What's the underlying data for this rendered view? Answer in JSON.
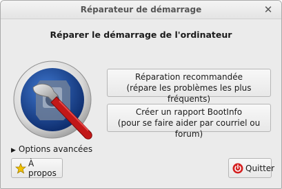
{
  "window": {
    "title": "Réparateur de démarrage"
  },
  "main": {
    "heading": "Réparer le démarrage de l'ordinateur",
    "repair_button": {
      "line1": "Réparation recommandée",
      "line2": "(répare les problèmes les plus fréquents)"
    },
    "bootinfo_button": {
      "line1": "Créer un rapport BootInfo",
      "line2": "(pour se faire aider par courriel ou forum)"
    },
    "options_label": "Options avancées"
  },
  "footer": {
    "about_label": "À propos",
    "quit_label": "Quitter"
  },
  "icons": {
    "close": "close-icon",
    "logo": "wrench-disk-logo",
    "about": "star-icon",
    "quit": "power-icon",
    "expander": "triangle-right-icon"
  },
  "colors": {
    "window_bg": "#ebebeb",
    "logo_blue": "#1d4fa0",
    "wrench_red": "#c21818",
    "quit_red": "#d42020",
    "star_yellow": "#f2c200"
  }
}
